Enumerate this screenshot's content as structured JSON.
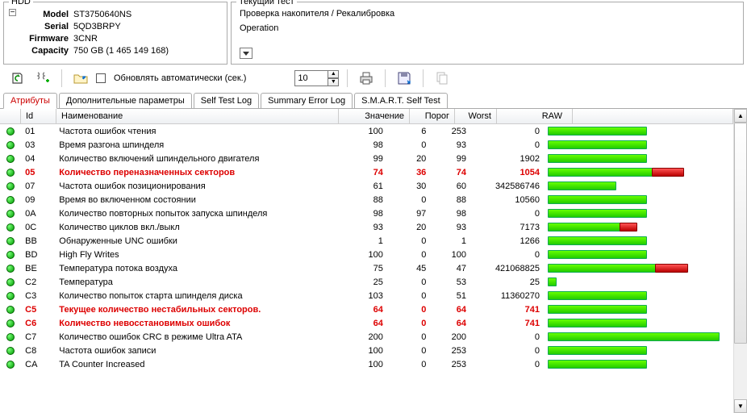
{
  "hdd_group_title": "HDD",
  "hdd": {
    "model_label": "Model",
    "model_value": "ST3750640NS",
    "serial_label": "Serial",
    "serial_value": "5QD3BRPY",
    "firmware_label": "Firmware",
    "firmware_value": "3CNR",
    "capacity_label": "Capacity",
    "capacity_value": "750 GB (1 465 149 168)"
  },
  "test_group_title": "Текущий тест",
  "test_line": "Проверка накопителя / Рекалибровка",
  "operation_label": "Operation",
  "toolbar": {
    "auto_update_label": "Обновлять автоматически (сек.)",
    "interval_value": "10"
  },
  "tabs": [
    "Атрибуты",
    "Дополнительные параметры",
    "Self Test Log",
    "Summary Error Log",
    "S.M.A.R.T. Self Test"
  ],
  "columns": {
    "id": "Id",
    "name": "Наименование",
    "value": "Значение",
    "threshold": "Порог",
    "worst": "Worst",
    "raw": "RAW"
  },
  "rows": [
    {
      "id": "01",
      "name": "Частота ошибок чтения",
      "val": "100",
      "por": "6",
      "worst": "253",
      "raw": "0",
      "alert": false,
      "g": 55,
      "r": 0
    },
    {
      "id": "03",
      "name": "Время разгона шпинделя",
      "val": "98",
      "por": "0",
      "worst": "93",
      "raw": "0",
      "alert": false,
      "g": 55,
      "r": 0
    },
    {
      "id": "04",
      "name": "Количество включений шпиндельного двигателя",
      "val": "99",
      "por": "20",
      "worst": "99",
      "raw": "1902",
      "alert": false,
      "g": 55,
      "r": 0
    },
    {
      "id": "05",
      "name": "Количество переназначенных секторов",
      "val": "74",
      "por": "36",
      "worst": "74",
      "raw": "1054",
      "alert": true,
      "g": 58,
      "r": 18
    },
    {
      "id": "07",
      "name": "Частота ошибок позиционирования",
      "val": "61",
      "por": "30",
      "worst": "60",
      "raw": "342586746",
      "alert": false,
      "g": 38,
      "r": 0
    },
    {
      "id": "09",
      "name": "Время во включенном состоянии",
      "val": "88",
      "por": "0",
      "worst": "88",
      "raw": "10560",
      "alert": false,
      "g": 55,
      "r": 0
    },
    {
      "id": "0A",
      "name": "Количество повторных попыток запуска шпинделя",
      "val": "98",
      "por": "97",
      "worst": "98",
      "raw": "0",
      "alert": false,
      "g": 55,
      "r": 0
    },
    {
      "id": "0C",
      "name": "Количество циклов вкл./выкл",
      "val": "93",
      "por": "20",
      "worst": "93",
      "raw": "7173",
      "alert": false,
      "g": 40,
      "r": 10
    },
    {
      "id": "BB",
      "name": "Обнаруженные UNC ошибки",
      "val": "1",
      "por": "0",
      "worst": "1",
      "raw": "1266",
      "alert": false,
      "g": 55,
      "r": 0
    },
    {
      "id": "BD",
      "name": "High Fly Writes",
      "val": "100",
      "por": "0",
      "worst": "100",
      "raw": "0",
      "alert": false,
      "g": 55,
      "r": 0
    },
    {
      "id": "BE",
      "name": "Температура потока воздуха",
      "val": "75",
      "por": "45",
      "worst": "47",
      "raw": "421068825",
      "alert": false,
      "g": 60,
      "r": 18
    },
    {
      "id": "C2",
      "name": "Температура",
      "val": "25",
      "por": "0",
      "worst": "53",
      "raw": "25",
      "alert": false,
      "g": 5,
      "r": 0
    },
    {
      "id": "C3",
      "name": "Количество попыток старта шпинделя диска",
      "val": "103",
      "por": "0",
      "worst": "51",
      "raw": "11360270",
      "alert": false,
      "g": 55,
      "r": 0
    },
    {
      "id": "C5",
      "name": "Текущее количество нестабильных секторов.",
      "val": "64",
      "por": "0",
      "worst": "64",
      "raw": "741",
      "alert": true,
      "g": 55,
      "r": 0
    },
    {
      "id": "C6",
      "name": "Количество невосстановимых ошибок",
      "val": "64",
      "por": "0",
      "worst": "64",
      "raw": "741",
      "alert": true,
      "g": 55,
      "r": 0
    },
    {
      "id": "C7",
      "name": "Количество ошибок CRC в режиме Ultra ATA",
      "val": "200",
      "por": "0",
      "worst": "200",
      "raw": "0",
      "alert": false,
      "g": 95,
      "r": 0
    },
    {
      "id": "C8",
      "name": "Частота ошибок записи",
      "val": "100",
      "por": "0",
      "worst": "253",
      "raw": "0",
      "alert": false,
      "g": 55,
      "r": 0
    },
    {
      "id": "CA",
      "name": "TA Counter Increased",
      "val": "100",
      "por": "0",
      "worst": "253",
      "raw": "0",
      "alert": false,
      "g": 55,
      "r": 0
    }
  ]
}
